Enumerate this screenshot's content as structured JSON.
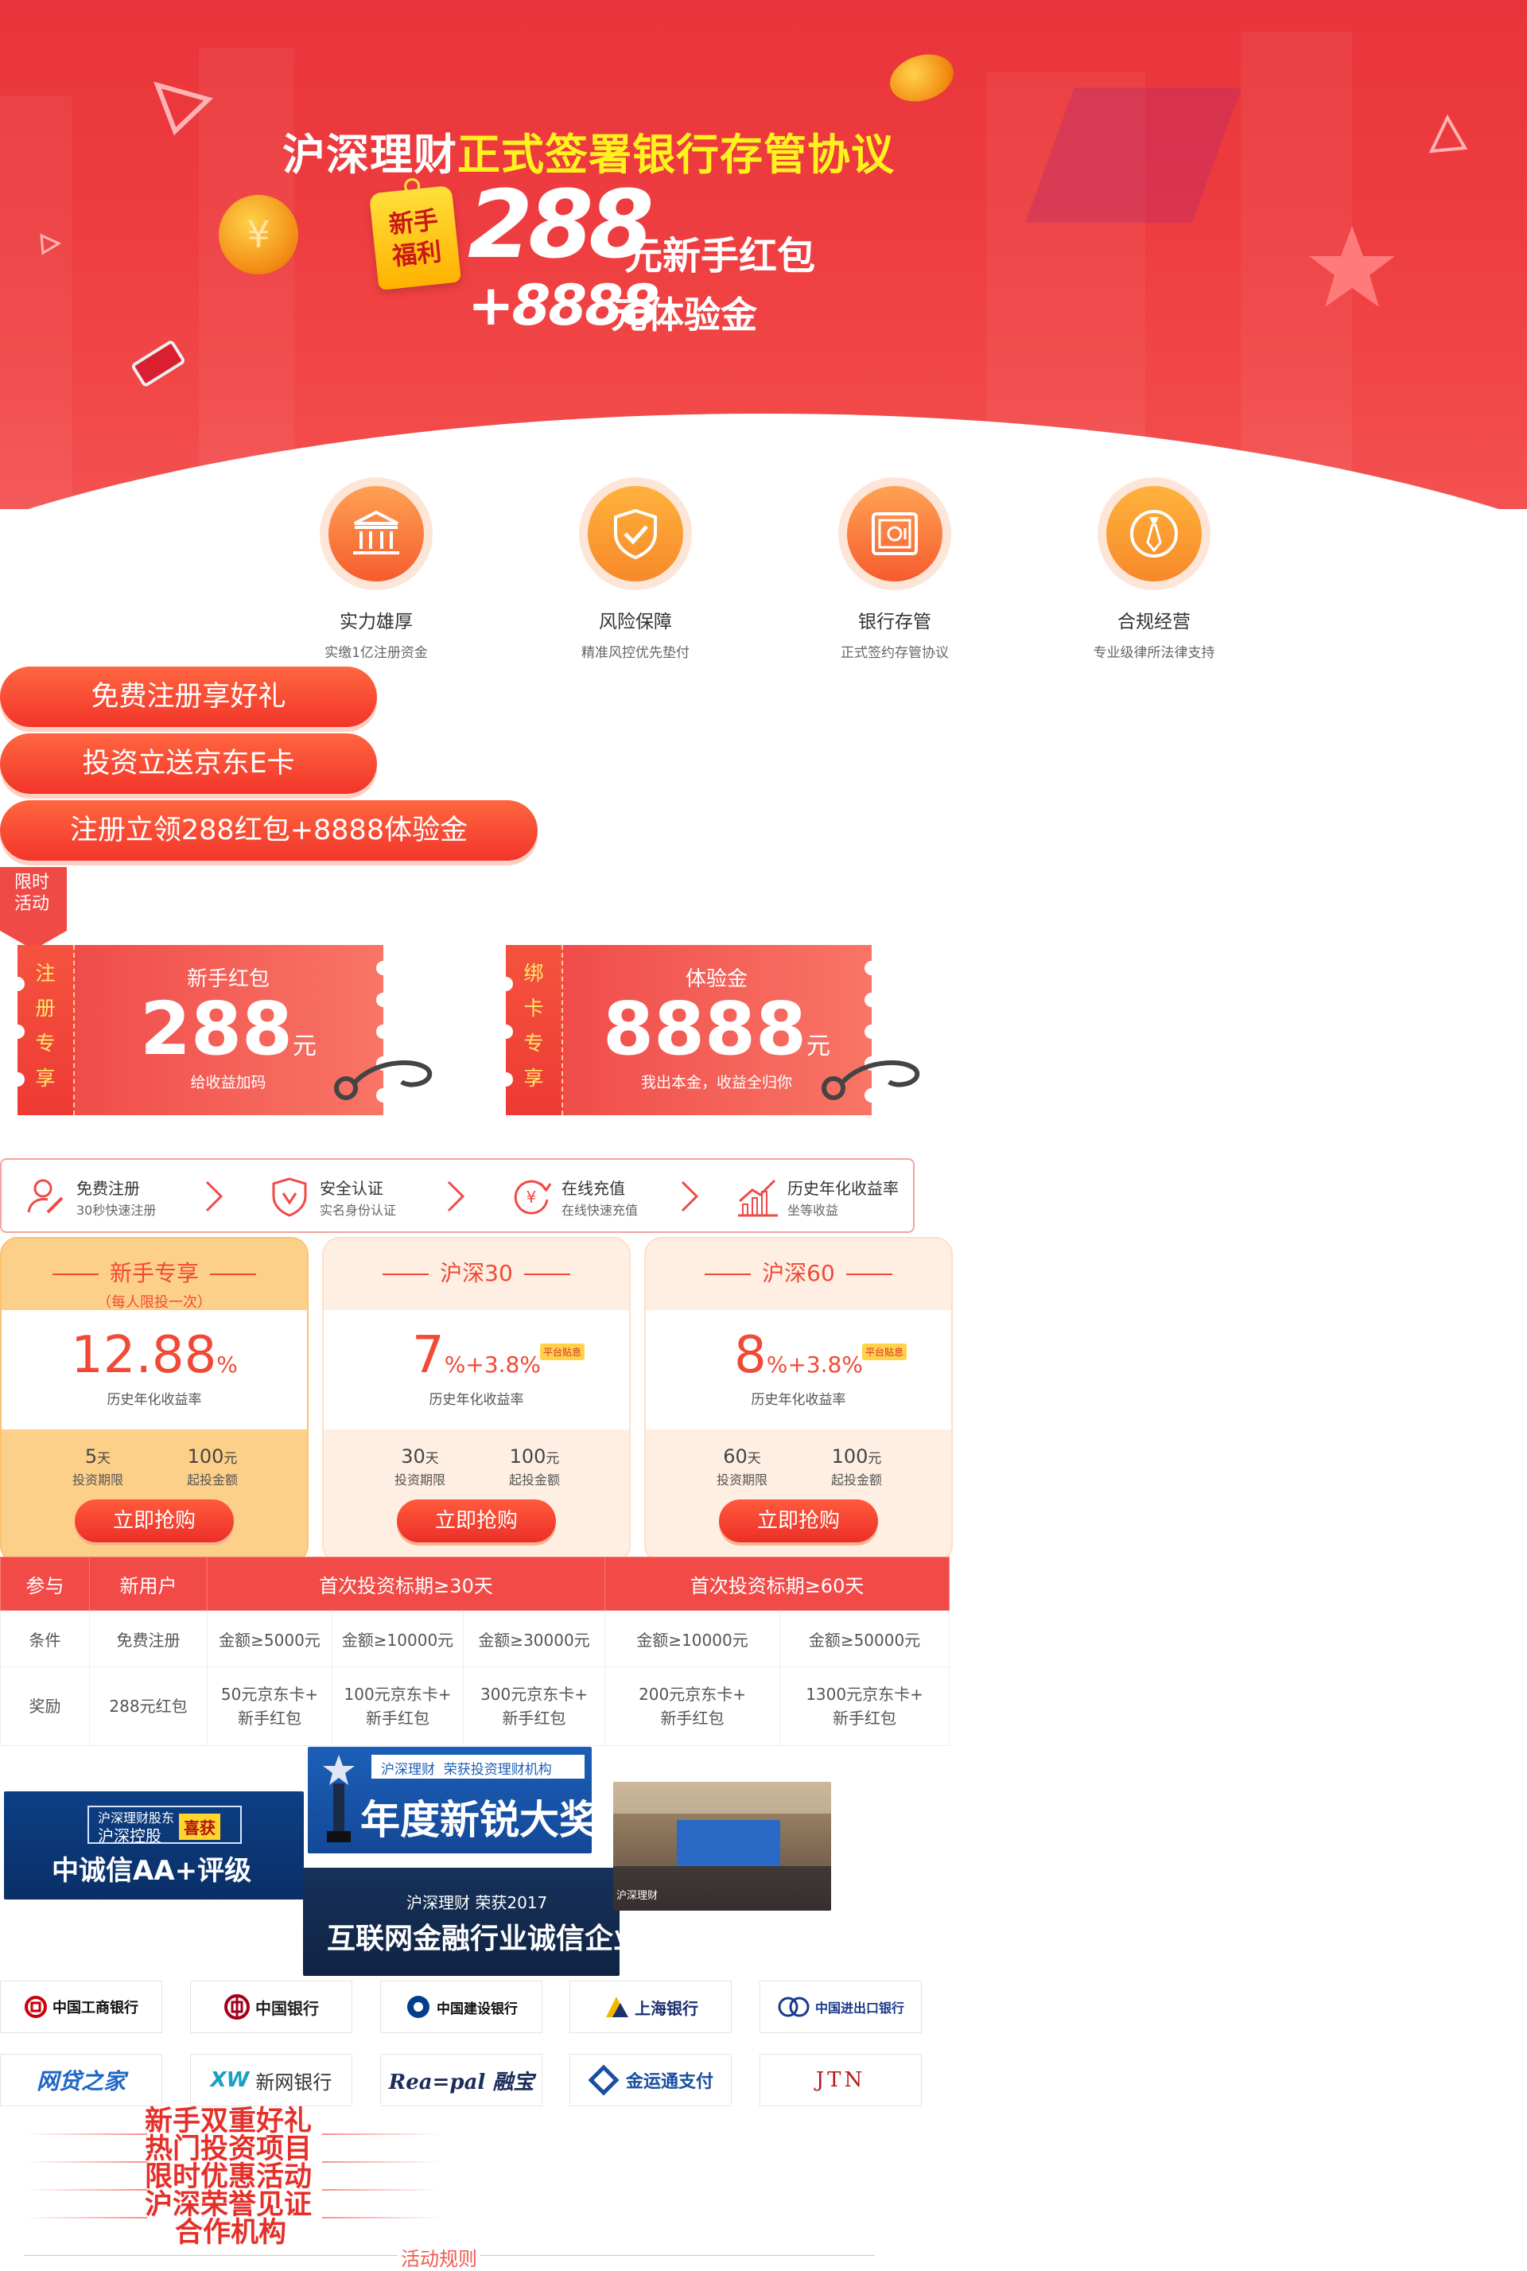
{
  "hero": {
    "line1_white": "沪深理财",
    "line1_yellow": "正式签署银行存管协议",
    "tag": [
      "新手",
      "福利"
    ],
    "amount1": "288",
    "amount1_suffix": "元新手红包",
    "amount2": "+8888",
    "amount2_suffix": "元体验金"
  },
  "features": [
    {
      "icon": "bank-icon",
      "title": "实力雄厚",
      "desc": "实缴1亿注册资金"
    },
    {
      "icon": "shield-check-icon",
      "title": "风险保障",
      "desc": "精准风控优先垫付"
    },
    {
      "icon": "safe-icon",
      "title": "银行存管",
      "desc": "正式签约存管协议"
    },
    {
      "icon": "tie-icon",
      "title": "合规经营",
      "desc": "专业级律所法律支持"
    }
  ],
  "cta_buttons": [
    "免费注册享好礼",
    "投资立送京东E卡",
    "注册立领288红包+8888体验金"
  ],
  "limited_badge": [
    "限时",
    "活动"
  ],
  "coupons": [
    {
      "side": [
        "注",
        "册",
        "专",
        "享"
      ],
      "title": "新手红包",
      "value": "288",
      "unit": "元",
      "sub": "给收益加码"
    },
    {
      "side": [
        "绑",
        "卡",
        "专",
        "享"
      ],
      "title": "体验金",
      "value": "8888",
      "unit": "元",
      "sub": "我出本金，收益全归你"
    }
  ],
  "steps": [
    {
      "icon": "user-edit-icon",
      "title": "免费注册",
      "desc": "30秒快速注册"
    },
    {
      "icon": "shield-v-icon",
      "title": "安全认证",
      "desc": "实名身份认证"
    },
    {
      "icon": "yuan-refresh-icon",
      "title": "在线充值",
      "desc": "在线快速充值"
    },
    {
      "icon": "growth-chart-icon",
      "title": "历史年化收益率",
      "desc": "坐等收益"
    }
  ],
  "products": [
    {
      "name": "新手专享",
      "note": "（每人限投一次）",
      "rate": "12.88",
      "rate_unit": "%",
      "bonus": "",
      "badge": "",
      "rate_label": "历史年化收益率",
      "term": "5",
      "term_unit": "天",
      "term_label": "投资期限",
      "min": "100",
      "min_unit": "元",
      "min_label": "起投金额",
      "button": "立即抢购"
    },
    {
      "name": "沪深30",
      "note": "",
      "rate": "7",
      "rate_unit": "%",
      "bonus": "+3.8%",
      "badge": "平台贴息",
      "rate_label": "历史年化收益率",
      "term": "30",
      "term_unit": "天",
      "term_label": "投资期限",
      "min": "100",
      "min_unit": "元",
      "min_label": "起投金额",
      "button": "立即抢购"
    },
    {
      "name": "沪深60",
      "note": "",
      "rate": "8",
      "rate_unit": "%",
      "bonus": "+3.8%",
      "badge": "平台贴息",
      "rate_label": "历史年化收益率",
      "term": "60",
      "term_unit": "天",
      "term_label": "投资期限",
      "min": "100",
      "min_unit": "元",
      "min_label": "起投金额",
      "button": "立即抢购"
    }
  ],
  "rules_table": {
    "headers": [
      "参与",
      "新用户",
      "首次投资标期≥30天",
      "首次投资标期≥60天"
    ],
    "row_conditions": [
      "条件",
      "免费注册",
      "金额≥5000元",
      "金额≥10000元",
      "金额≥30000元",
      "金额≥10000元",
      "金额≥50000元"
    ],
    "row_rewards": [
      "奖励",
      "288元红包",
      "50元京东卡+|新手红包",
      "100元京东卡+|新手红包",
      "300元京东卡+|新手红包",
      "200元京东卡+|新手红包",
      "1300元京东卡+|新手红包"
    ]
  },
  "awards": {
    "aa": {
      "top": "沪深理财股东",
      "top2": "沪深控股",
      "badge": "喜获",
      "main": "中诚信AA+评级"
    },
    "rookie": {
      "brand": "沪深理财",
      "sub": "荣获投资理财机构",
      "main": "年度新锐大奖"
    },
    "honest": {
      "top": "沪深理财 荣获2017",
      "main": "互联网金融行业诚信企业奖"
    },
    "photo_caption": "沪深理财"
  },
  "partners": [
    {
      "name": "中国工商银行",
      "color": "#c7000b"
    },
    {
      "name": "中国银行",
      "color": "#a3001b"
    },
    {
      "name": "中国建设银行",
      "color": "#003f8e"
    },
    {
      "name": "上海银行",
      "color": "#1a2f6e"
    },
    {
      "name": "中国进出口银行",
      "color": "#1a3a8c"
    },
    {
      "name": "网贷之家",
      "color": "#1f66c9"
    },
    {
      "name": "新网银行",
      "color": "#333333"
    },
    {
      "name": "Rea=pal 融宝",
      "color": "#1d2d5a"
    },
    {
      "name": "金运通支付",
      "color": "#1a4ea0"
    },
    {
      "name": "JTN",
      "color": "#b51919"
    }
  ],
  "bottom_nav": [
    "新手双重好礼",
    "热门投资项目",
    "限时优惠活动",
    "沪深荣誉见证",
    "合作机构"
  ],
  "activity_rules": "活动规则"
}
